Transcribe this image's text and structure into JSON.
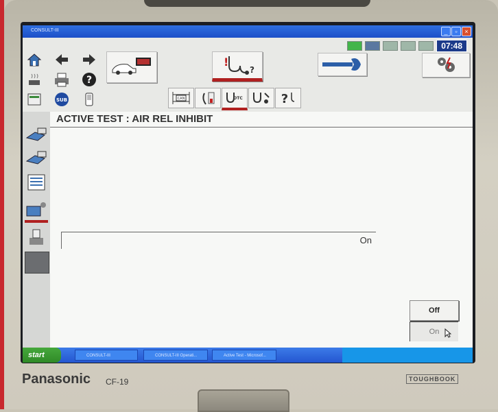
{
  "window": {
    "title": "CONSULT-III",
    "controls": {
      "minimize": "_",
      "restore": "▫",
      "close": "×"
    }
  },
  "status": {
    "clock": "07:48"
  },
  "toolbar": {
    "nav": [
      "home-icon",
      "back-arrow-icon",
      "forward-arrow-icon",
      "settings-icon",
      "print-icon",
      "help-icon",
      "screen-icon",
      "sub-icon",
      "device-icon"
    ],
    "main_buttons": [
      "vehicle-ecu-icon",
      "diagnosis-icon",
      "wrench-icon",
      "gears-icon"
    ],
    "sub_buttons": [
      "can-icon",
      "data-monitor-icon",
      "dtc-icon",
      "active-test-icon",
      "help-question-icon"
    ],
    "sub_labels": {
      "can": "CAN",
      "dtc": "DTC"
    },
    "sub_home": "SUB"
  },
  "sidebar": [
    "left-tool-1-icon",
    "left-tool-2-icon",
    "left-tool-3-icon",
    "left-tool-4-icon",
    "left-tool-5-icon",
    "left-tool-6-icon"
  ],
  "content": {
    "title": "ACTIVE TEST : AIR REL INHIBIT",
    "value": "On",
    "off_button": "Off",
    "on_button": "On"
  },
  "taskbar": {
    "start": "start",
    "tasks": [
      "CONSULT-III",
      "CONSULT-III Operati...",
      "Active Test - Microsof..."
    ]
  },
  "hardware": {
    "brand": "Panasonic",
    "model": "CF-19",
    "badge": "TOUGHBOOK"
  },
  "colors": {
    "accent": "#b02020",
    "titlebar": "#1d4fc8",
    "taskbar": "#2456d0"
  }
}
